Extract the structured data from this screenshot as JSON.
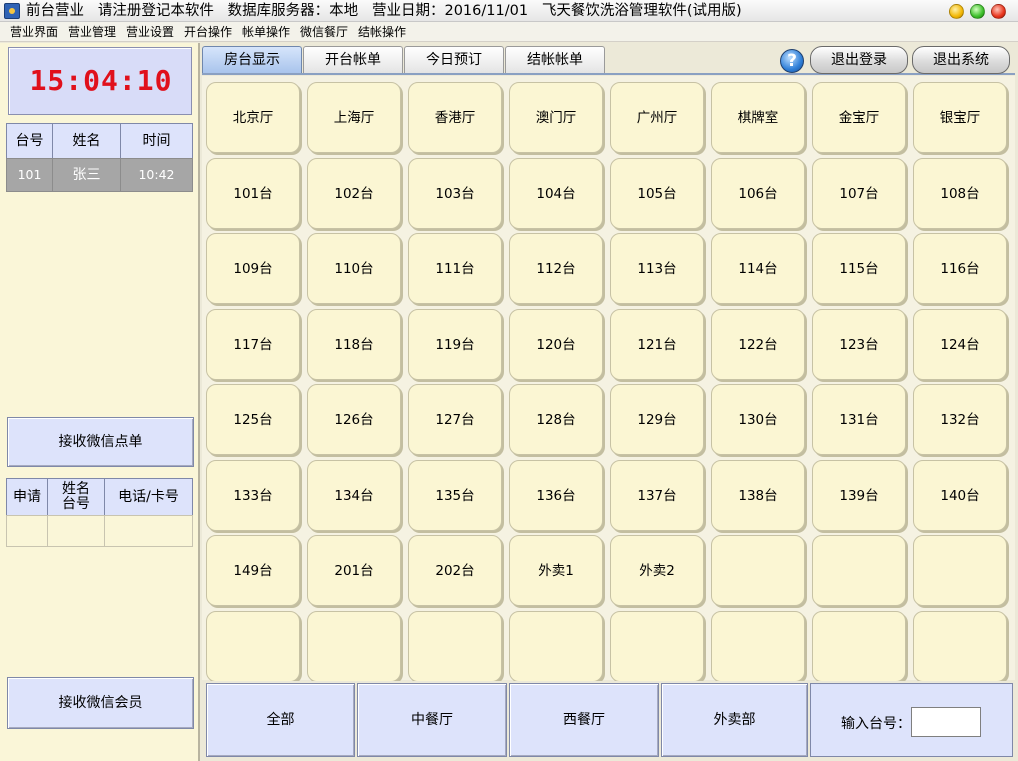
{
  "titlebar": {
    "text": "前台营业   请注册登记本软件   数据库服务器：本地   营业日期：2016/11/01   飞天餐饮洗浴管理软件(试用版)"
  },
  "menu": [
    "营业界面",
    "营业管理",
    "营业设置",
    "开台操作",
    "帐单操作",
    "微信餐厅",
    "结帐操作"
  ],
  "clock": "15:04:10",
  "open_tables": {
    "headers": [
      "台号",
      "姓名",
      "时间"
    ],
    "rows": [
      {
        "table": "101",
        "name": "张三",
        "time": "10:42"
      }
    ]
  },
  "wechat_order_button": "接收微信点单",
  "wechat_list": {
    "headers": [
      "申请",
      "姓名\n台号",
      "电话/卡号"
    ]
  },
  "wechat_member_button": "接收微信会员",
  "tabs": [
    "房台显示",
    "开台帐单",
    "今日预订",
    "结帐帐单"
  ],
  "help_icon": "?",
  "logout_button": "退出登录",
  "exit_button": "退出系统",
  "tiles": [
    "北京厅",
    "上海厅",
    "香港厅",
    "澳门厅",
    "广州厅",
    "棋牌室",
    "金宝厅",
    "银宝厅",
    "101台",
    "102台",
    "103台",
    "104台",
    "105台",
    "106台",
    "107台",
    "108台",
    "109台",
    "110台",
    "111台",
    "112台",
    "113台",
    "114台",
    "115台",
    "116台",
    "117台",
    "118台",
    "119台",
    "120台",
    "121台",
    "122台",
    "123台",
    "124台",
    "125台",
    "126台",
    "127台",
    "128台",
    "129台",
    "130台",
    "131台",
    "132台",
    "133台",
    "134台",
    "135台",
    "136台",
    "137台",
    "138台",
    "139台",
    "140台",
    "149台",
    "201台",
    "202台",
    "外卖1",
    "外卖2",
    "",
    "",
    "",
    "",
    "",
    "",
    "",
    "",
    "",
    "",
    ""
  ],
  "categories": [
    "全部",
    "中餐厅",
    "西餐厅",
    "外卖部"
  ],
  "table_input": {
    "label": "输入台号：",
    "value": ""
  }
}
